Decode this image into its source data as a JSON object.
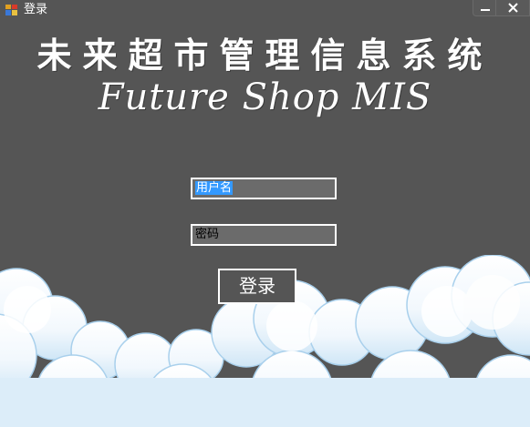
{
  "window": {
    "title": "登录",
    "icon": "app-grid-icon",
    "controls": [
      "minimize-icon",
      "close-icon"
    ]
  },
  "header": {
    "title_cn": "未来超市管理信息系统",
    "title_en": "Future Shop MIS"
  },
  "form": {
    "username": {
      "value": "用户名"
    },
    "password": {
      "value": "密码"
    },
    "login_label": "登录"
  },
  "colors": {
    "background": "#555555",
    "field_border": "#ffffff",
    "field_background": "#6b6b6b",
    "selection": "#3399ff",
    "cloud": "#ffffff",
    "cloud_shade": "#bcdcf2"
  }
}
